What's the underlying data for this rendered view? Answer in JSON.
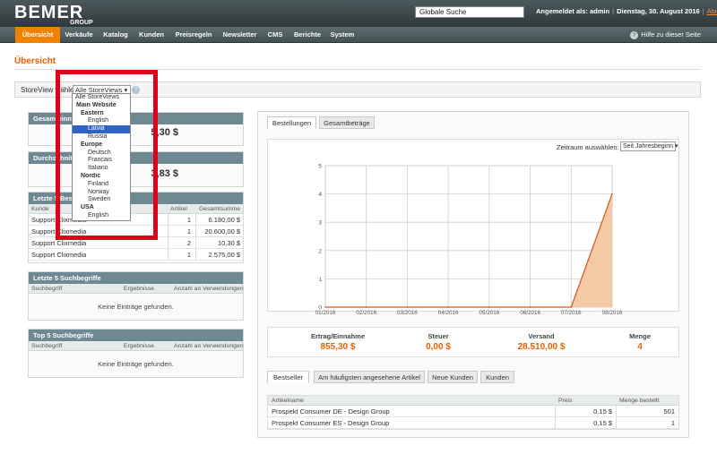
{
  "header": {
    "logo_text": "BEMER",
    "logo_sub": "GROUP",
    "search_value": "Globale Suche",
    "logged_in": "Angemeldet als: admin",
    "date": "Dienstag, 30. August 2016",
    "logout": "Abmelden"
  },
  "nav": {
    "items": [
      "Übersicht",
      "Verkäufe",
      "Katalog",
      "Kunden",
      "Preisregeln",
      "Newsletter",
      "CMS",
      "Berichte",
      "System"
    ],
    "help": "Hilfe zu dieser Seite"
  },
  "page_title": "Übersicht",
  "storeview": {
    "label": "StoreView wählen",
    "selected": "Alle StoreViews",
    "help_icon": "?",
    "options": [
      {
        "text": "Alle StoreViews",
        "level": "o0"
      },
      {
        "text": "Main Website",
        "level": "g1"
      },
      {
        "text": "Eastern",
        "level": "g2"
      },
      {
        "text": "English",
        "level": "o"
      },
      {
        "text": "Latvia",
        "level": "o",
        "selected": true
      },
      {
        "text": "Russia",
        "level": "o"
      },
      {
        "text": "Europe",
        "level": "g2"
      },
      {
        "text": "Deutsch",
        "level": "o"
      },
      {
        "text": "Francais",
        "level": "o"
      },
      {
        "text": "Italiano",
        "level": "o"
      },
      {
        "text": "Nordic",
        "level": "g2"
      },
      {
        "text": "Finland",
        "level": "o"
      },
      {
        "text": "Norway",
        "level": "o"
      },
      {
        "text": "Sweden",
        "level": "o"
      },
      {
        "text": "USA",
        "level": "g2"
      },
      {
        "text": "English",
        "level": "o"
      }
    ]
  },
  "boxes": {
    "gesamt_head": "Gesamteinna",
    "gesamt_value": "5,30 $",
    "durch_head": "Durchschnittl",
    "durch_value": "3,83 $",
    "letzte_head": "Letzte 5 Beste",
    "orders_cols": [
      "Kunde",
      "Artikel",
      "Gesamtsumme"
    ],
    "orders": [
      {
        "kunde": "Support Clixmedia",
        "artikel": "1",
        "summe": "6.180,00 $"
      },
      {
        "kunde": "Support Clixmedia",
        "artikel": "1",
        "summe": "20.600,00 $"
      },
      {
        "kunde": "Support Clixmedia",
        "artikel": "2",
        "summe": "10,30 $"
      },
      {
        "kunde": "Support Clixmedia",
        "artikel": "1",
        "summe": "2.575,00 $"
      }
    ],
    "suche_head": "Letzte 5 Suchbegriffe",
    "top_head": "Top 5 Suchbegriffe",
    "search_cols": [
      "Suchbegriff",
      "Ergebnisse",
      "Anzahl an Verwendungen"
    ],
    "empty": "Keine Einträge gefunden."
  },
  "right": {
    "tabs": [
      "Bestellungen",
      "Gesamtbeträge"
    ],
    "zeitraum_label": "Zeitraum auswählen:",
    "zeitraum_value": "Seit Jahresbeginn",
    "stats": [
      {
        "label": "Ertrag/Einnahme",
        "value": "855,30 $"
      },
      {
        "label": "Steuer",
        "value": "0,00 $"
      },
      {
        "label": "Versand",
        "value": "28.510,00 $"
      },
      {
        "label": "Menge",
        "value": "4"
      }
    ],
    "bottom_tabs": [
      "Bestseller",
      "Am häufigsten angesehene Artikel",
      "Neue Kunden",
      "Kunden"
    ],
    "bs_cols": [
      "Artikelname",
      "Preis",
      "Menge bestellt"
    ],
    "bestsellers": [
      {
        "name": "Prospekt Consumer DE - Design Group",
        "preis": "0,15 $",
        "menge": "501"
      },
      {
        "name": "Prospekt Consumer ES - Design Group",
        "preis": "0,15 $",
        "menge": "1"
      }
    ]
  },
  "chart_data": {
    "type": "area",
    "categories": [
      "01/2016",
      "02/2016",
      "03/2016",
      "04/2016",
      "05/2016",
      "06/2016",
      "07/2016",
      "08/2016"
    ],
    "y_ticks": [
      "0",
      "1",
      "2",
      "3",
      "4",
      "5"
    ],
    "series": [
      {
        "values": [
          0,
          0,
          0,
          0,
          0,
          0,
          0,
          4
        ]
      }
    ],
    "ylim": [
      0,
      5
    ],
    "grid": true,
    "colors": {
      "line": "#d9531e",
      "fill": "#f3c9a6",
      "grid": "#cfcfcf"
    }
  }
}
